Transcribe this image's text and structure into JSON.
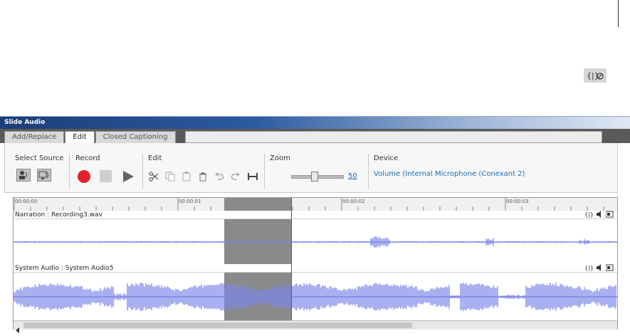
{
  "panel": {
    "title": "Slide Audio",
    "tabs": [
      {
        "label": "Add/Replace",
        "active": false
      },
      {
        "label": "Edit",
        "active": true
      },
      {
        "label": "Closed Captioning",
        "active": false
      }
    ]
  },
  "groups": {
    "select_source": "Select Source",
    "record": "Record",
    "edit": "Edit",
    "zoom": "Zoom",
    "device": "Device"
  },
  "zoom": {
    "value": "50",
    "level": 0.45
  },
  "device": {
    "name": "Volume (Internal Microphone (Conexant 2)"
  },
  "timeline": {
    "ticks": [
      "00:00:00",
      "00:00:01",
      "00:00:02",
      "00:00:03"
    ],
    "tracks": [
      {
        "label": "Narration : Recording3.wav"
      },
      {
        "label": "System Audio : System Audio5"
      }
    ]
  },
  "colors": {
    "waveform": "#7b86e8",
    "playhead": "#e02020",
    "record": "#e0222b",
    "accent": "#1a6fb4"
  },
  "icons": [
    "audio-options-icon",
    "microphone-source-icon",
    "system-audio-source-icon",
    "record-icon",
    "stop-icon",
    "play-icon",
    "cut-icon",
    "copy-icon",
    "paste-icon",
    "delete-icon",
    "undo-icon",
    "redo-icon",
    "insert-silence-icon",
    "mute-icon",
    "volume-icon"
  ]
}
